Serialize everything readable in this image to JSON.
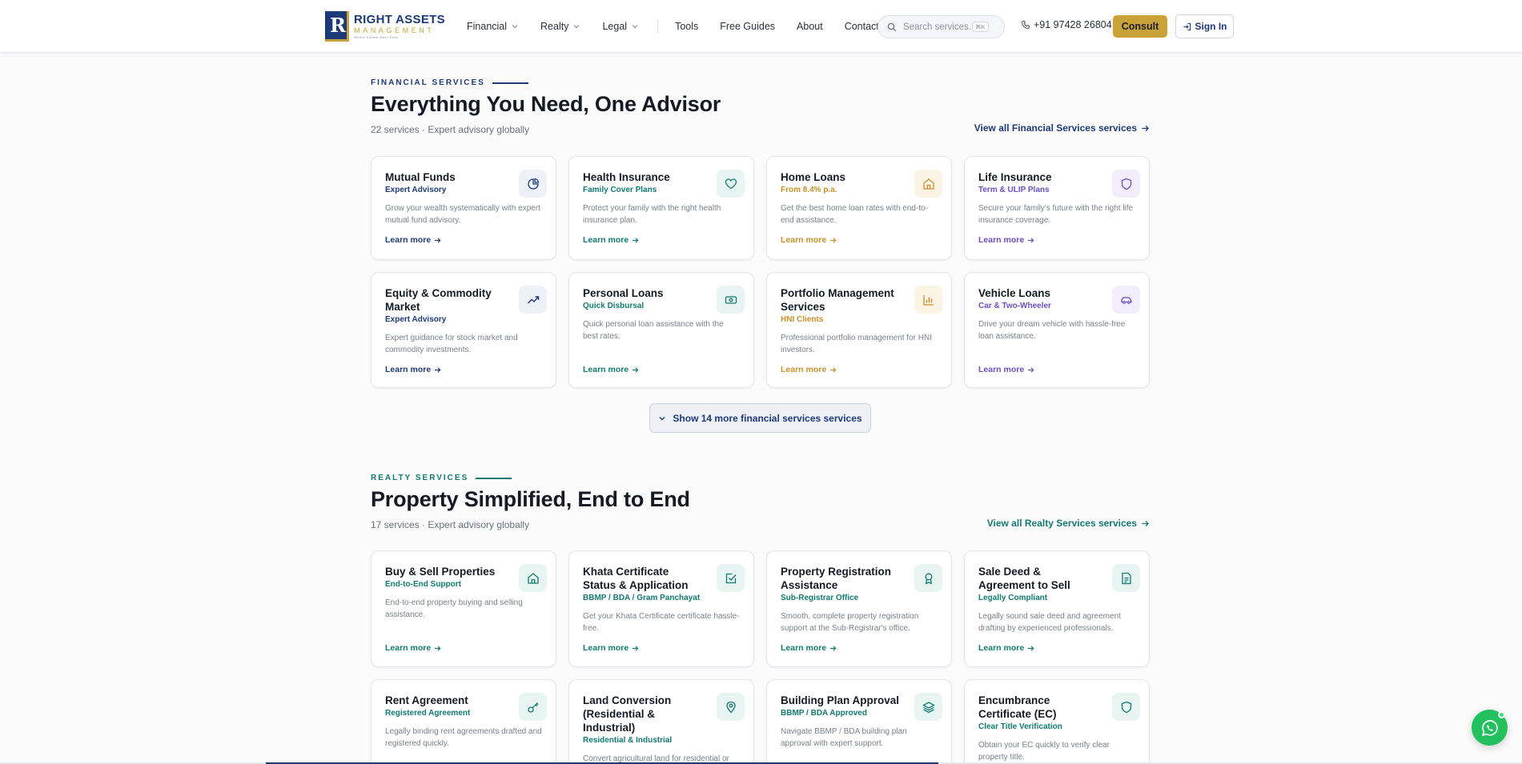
{
  "header": {
    "logo_line1": "RIGHT ASSETS",
    "logo_line2": "MANAGEMENT",
    "logo_tagline": "Where Assets Meet Ease",
    "nav": [
      {
        "label": "Financial",
        "dropdown": true
      },
      {
        "label": "Realty",
        "dropdown": true
      },
      {
        "label": "Legal",
        "dropdown": true
      },
      {
        "label": "Tools",
        "dropdown": false
      },
      {
        "label": "Free Guides",
        "dropdown": false
      },
      {
        "label": "About",
        "dropdown": false
      },
      {
        "label": "Contact",
        "dropdown": false
      }
    ],
    "search_placeholder": "Search services...",
    "search_shortcut": "⌘K",
    "phone": "+91 97428 26804",
    "consult_label": "Consult",
    "signin_label": "Sign In"
  },
  "colors": {
    "navy": "#1d3a78",
    "gold": "#c9a23a",
    "teal": "#137a72",
    "amber": "#c8912b",
    "purple": "#6b4fbf"
  },
  "financial": {
    "eyebrow": "FINANCIAL SERVICES",
    "title": "Everything You Need, One Advisor",
    "subtitle": "22 services · Expert advisory globally",
    "view_all": "View all Financial Services services",
    "show_more": "Show 14 more financial services services",
    "cards": [
      {
        "title": "Mutual Funds",
        "tag": "Expert Advisory",
        "desc": "Grow your wealth systematically with expert mutual fund advisory.",
        "link": "Learn more",
        "icon": "pie-chart-icon",
        "accent": "navy"
      },
      {
        "title": "Health Insurance",
        "tag": "Family Cover Plans",
        "desc": "Protect your family with the right health insurance plan.",
        "link": "Learn more",
        "icon": "heart-icon",
        "accent": "teal"
      },
      {
        "title": "Home Loans",
        "tag": "From 8.4% p.a.",
        "desc": "Get the best home loan rates with end-to-end assistance.",
        "link": "Learn more",
        "icon": "home-icon",
        "accent": "amber"
      },
      {
        "title": "Life Insurance",
        "tag": "Term & ULIP Plans",
        "desc": "Secure your family's future with the right life insurance coverage.",
        "link": "Learn more",
        "icon": "shield-icon",
        "accent": "purple"
      },
      {
        "title": "Equity & Commodity Market",
        "tag": "Expert Advisory",
        "desc": "Expert guidance for stock market and commodity investments.",
        "link": "Learn more",
        "icon": "trending-up-icon",
        "accent": "navy"
      },
      {
        "title": "Personal Loans",
        "tag": "Quick Disbursal",
        "desc": "Quick personal loan assistance with the best rates.",
        "link": "Learn more",
        "icon": "banknote-icon",
        "accent": "teal"
      },
      {
        "title": "Portfolio Management Services",
        "tag": "HNI Clients",
        "desc": "Professional portfolio management for HNI investors.",
        "link": "Learn more",
        "icon": "bar-chart-icon",
        "accent": "amber"
      },
      {
        "title": "Vehicle Loans",
        "tag": "Car & Two-Wheeler",
        "desc": "Drive your dream vehicle with hassle-free loan assistance.",
        "link": "Learn more",
        "icon": "car-icon",
        "accent": "purple"
      }
    ]
  },
  "realty": {
    "eyebrow": "REALTY SERVICES",
    "title": "Property Simplified, End to End",
    "subtitle": "17 services · Expert advisory globally",
    "view_all": "View all Realty Services services",
    "cards": [
      {
        "title": "Buy & Sell Properties",
        "tag": "End-to-End Support",
        "desc": "End-to-end property buying and selling assistance.",
        "link": "Learn more",
        "icon": "home-icon"
      },
      {
        "title": "Khata Certificate Status & Application",
        "tag": "BBMP / BDA / Gram Panchayat",
        "desc": "Get your Khata Certificate certificate hassle-free.",
        "link": "Learn more",
        "icon": "check-square-icon"
      },
      {
        "title": "Property Registration Assistance",
        "tag": "Sub-Registrar Office",
        "desc": "Smooth, complete property registration support at the Sub-Registrar's office.",
        "link": "Learn more",
        "icon": "award-icon"
      },
      {
        "title": "Sale Deed & Agreement to Sell",
        "tag": "Legally Compliant",
        "desc": "Legally sound sale deed and agreement drafting by experienced professionals.",
        "link": "Learn more",
        "icon": "document-icon"
      },
      {
        "title": "Rent Agreement",
        "tag": "Registered Agreement",
        "desc": "Legally binding rent agreements drafted and registered quickly.",
        "link": "Learn more",
        "icon": "key-icon"
      },
      {
        "title": "Land Conversion (Residential & Industrial)",
        "tag": "Residential & Industrial",
        "desc": "Convert agricultural land for residential or",
        "link": "Learn more",
        "icon": "map-pin-icon"
      },
      {
        "title": "Building Plan Approval",
        "tag": "BBMP / BDA Approved",
        "desc": "Navigate BBMP / BDA building plan approval with expert support.",
        "link": "Learn more",
        "icon": "layers-icon"
      },
      {
        "title": "Encumbrance Certificate (EC)",
        "tag": "Clear Title Verification",
        "desc": "Obtain your EC quickly to verify clear property title.",
        "link": "Learn more",
        "icon": "shield-icon"
      }
    ]
  }
}
